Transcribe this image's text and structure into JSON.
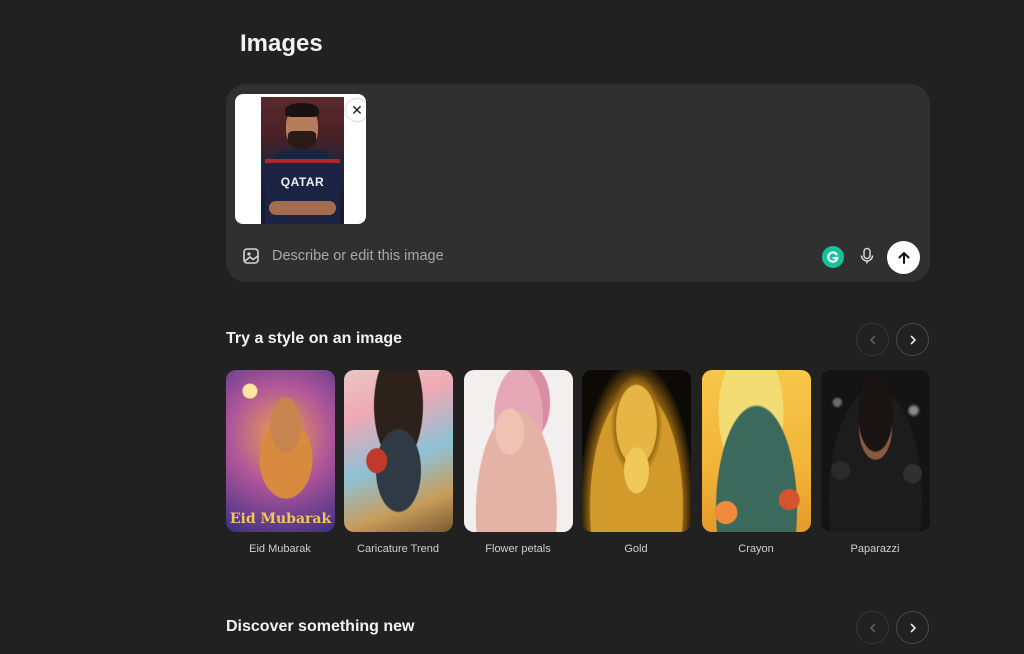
{
  "page": {
    "title": "Images"
  },
  "composer": {
    "attachment": {
      "jersey_text": "QATAR"
    },
    "placeholder": "Describe or edit this image",
    "value": ""
  },
  "sections": [
    {
      "title": "Try a style on an image",
      "styles": [
        {
          "label": "Eid Mubarak",
          "card_text": "Eid Mubarak"
        },
        {
          "label": "Caricature Trend"
        },
        {
          "label": "Flower petals"
        },
        {
          "label": "Gold"
        },
        {
          "label": "Crayon"
        },
        {
          "label": "Paparazzi"
        }
      ]
    },
    {
      "title": "Discover something new"
    }
  ],
  "colors": {
    "background": "#212121",
    "composer": "#303030",
    "grammarly": "#15c39a",
    "send_button": "#ffffff"
  },
  "icons": [
    "close-icon",
    "image-icon",
    "grammarly-icon",
    "microphone-icon",
    "arrow-up-icon",
    "chevron-left-icon",
    "chevron-right-icon"
  ]
}
